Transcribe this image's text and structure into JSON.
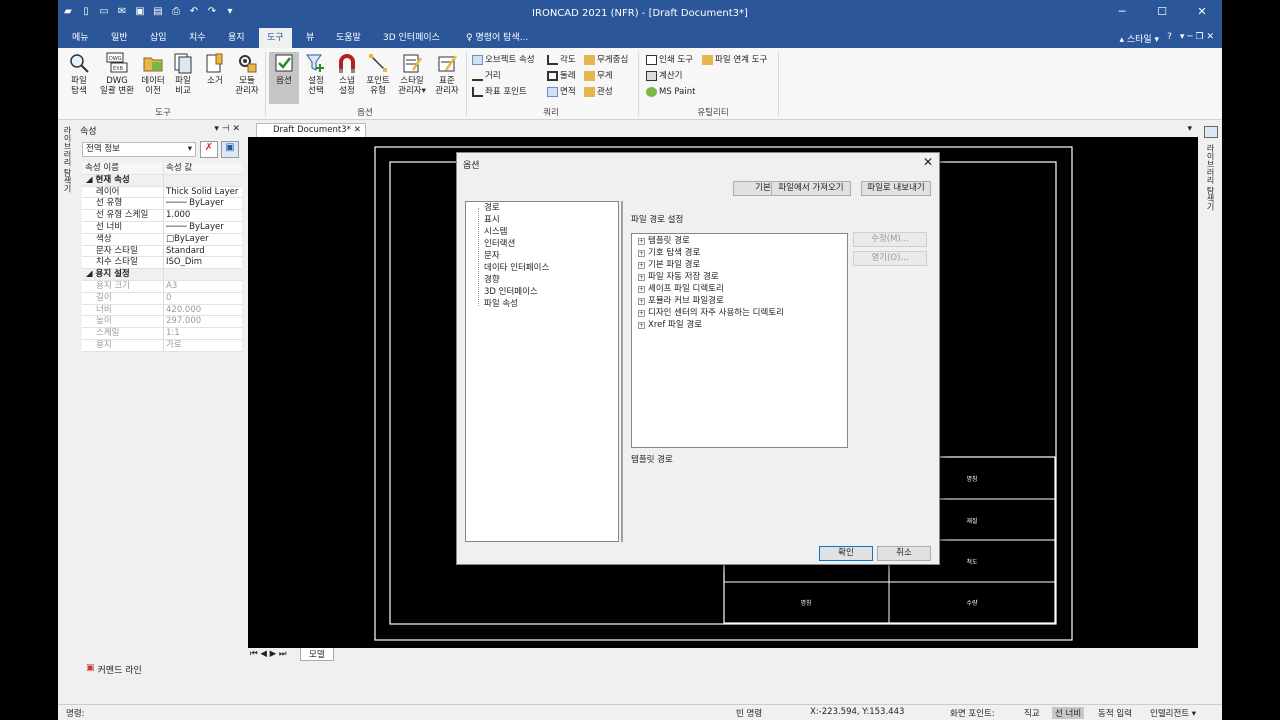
{
  "window": {
    "title": "IRONCAD 2021 (NFR) - [Draft Document3*]",
    "minimize": "─",
    "maximize": "☐",
    "close": "✕"
  },
  "menu": {
    "tabs": [
      "메뉴",
      "일반",
      "삽입",
      "치수",
      "용지",
      "도구",
      "뷰",
      "도움말",
      "3D 인터페이스"
    ],
    "search_placeholder": "명령어 탐색...",
    "style_label": "스타일",
    "help": "?"
  },
  "ribbon": {
    "tool_buttons": [
      {
        "l1": "파일",
        "l2": "탐색"
      },
      {
        "l1": "DWG",
        "l2": "일괄 변환"
      },
      {
        "l1": "데이터",
        "l2": "이전"
      },
      {
        "l1": "파일",
        "l2": "비교"
      },
      {
        "l1": "소거",
        "l2": ""
      },
      {
        "l1": "모듈",
        "l2": "관리자"
      }
    ],
    "option_buttons": [
      {
        "l1": "옵션",
        "l2": ""
      },
      {
        "l1": "설정",
        "l2": "선택"
      },
      {
        "l1": "스냅",
        "l2": "설정"
      },
      {
        "l1": "포인트",
        "l2": "유형"
      },
      {
        "l1": "스타일",
        "l2": "관리자▾"
      },
      {
        "l1": "표준",
        "l2": "관리자"
      }
    ],
    "query_items": [
      "오브젝트 속성",
      "각도",
      "무게중심",
      "거리",
      "둘레",
      "무게",
      "좌표 포인트",
      "면적",
      "관성"
    ],
    "util_items": [
      "인쇄 도구",
      "파일 연계 도구",
      "계산기",
      "MS Paint"
    ],
    "groups": {
      "tools": "도구",
      "options": "옵션",
      "query": "쿼리",
      "utility": "유틸리티"
    }
  },
  "props": {
    "panel_title": "속성",
    "side_tab": "라이브러리 탐색기",
    "dropdown": "전역 정보",
    "col_name": "속성 이름",
    "col_value": "속성 값",
    "cat_current": "현재 속성",
    "current": [
      [
        "레이어",
        "Thick Solid Layer"
      ],
      [
        "선 유형",
        "──── ByLayer"
      ],
      [
        "선 유형 스케일",
        "1.000"
      ],
      [
        "선 너비",
        "──── ByLayer"
      ],
      [
        "색상",
        "□ByLayer"
      ],
      [
        "문자 스타일",
        "Standard"
      ],
      [
        "치수 스타일",
        "ISO_Dim"
      ]
    ],
    "cat_paper": "용지 설정",
    "paper": [
      [
        "용지 크기",
        "A3"
      ],
      [
        "길이",
        "0"
      ],
      [
        "너비",
        "420.000"
      ],
      [
        "높이",
        "297.000"
      ],
      [
        "스케일",
        "1:1"
      ],
      [
        "용지",
        "가로"
      ]
    ],
    "command_line": "커맨드 라인"
  },
  "document": {
    "tab": "Draft Document3*",
    "sheet_tab": "모델",
    "sheet_nav": "⏮ ◀ ▶ ⏭"
  },
  "drawing": {
    "title_cells": [
      "명칭",
      "재질",
      "척도",
      "명칭",
      "수량"
    ]
  },
  "dialog": {
    "title": "옵션",
    "btn_default": "기본",
    "btn_import": "파일에서 가져오기",
    "btn_export": "파일로 내보내기",
    "nav": [
      "경로",
      "표시",
      "시스템",
      "인터랙션",
      "문자",
      "데이타 인터페이스",
      "경향",
      "3D 인터페이스",
      "파일 속성"
    ],
    "section_title": "파일 경로 설정",
    "paths": [
      "템플릿 경로",
      "기호 탐색 경로",
      "기본 파일 경로",
      "파일 자동 저장 경로",
      "셰이프 파일 디렉토리",
      "포뮬라 커브 파일경로",
      "디자인 센터의 자주 사용하는 디렉토리",
      "Xref 파일 경로"
    ],
    "btn_edit": "수정(M)...",
    "btn_open": "열기(O)...",
    "desc": "템플릿 경로",
    "btn_ok": "확인",
    "btn_cancel": "취소"
  },
  "status": {
    "prompt": "명령:",
    "empty_cmd": "빈 명령",
    "coords": "X:-223.594, Y:153.443",
    "screen_point": "화면 포인트:",
    "ortho": "직교",
    "linewidth": "선 너비",
    "dyn_input": "동적 입력",
    "intellidim": "인텔리전트 ▾"
  }
}
